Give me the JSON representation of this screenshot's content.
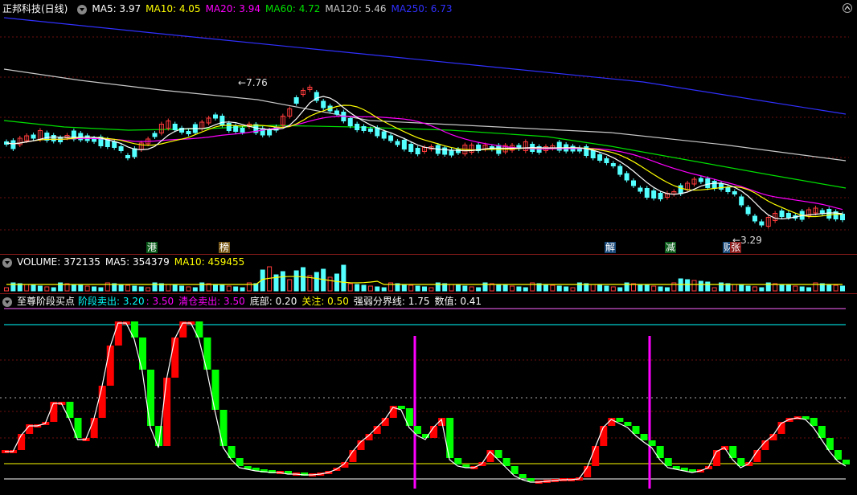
{
  "main": {
    "title": "正邦科技(日线)",
    "ma5": "MA5: 3.97",
    "ma10": "MA10: 4.05",
    "ma20": "MA20: 3.94",
    "ma60": "MA60: 4.72",
    "ma120": "MA120: 5.46",
    "ma250": "MA250: 6.73",
    "high_label": "7.76",
    "low_label": "3.29",
    "tags": [
      "港",
      "榜",
      "解",
      "减",
      "财",
      "张"
    ]
  },
  "volume": {
    "label": "VOLUME: 372135",
    "ma5": "MA5: 354379",
    "ma10": "MA10: 459455"
  },
  "indicator": {
    "title": "至尊阶段买点",
    "stage_sell": "阶段卖出: 3.20",
    "colon_val": ": 3.50",
    "clear_sell": "清仓卖出: 3.50",
    "bottom": "底部: 0.20",
    "focus": "关注: 0.50",
    "divide": "强弱分界线: 1.75",
    "value": "数值: 0.41"
  },
  "colors": {
    "up": "#ff3c3c",
    "down": "#54ffff",
    "ma5": "#ffffff",
    "ma10": "#ffff00",
    "ma20": "#ff00ff",
    "ma60": "#00e000",
    "ma120": "#c8c8c8",
    "ma250": "#3030ff",
    "ind_up": "#ff0000",
    "ind_down": "#00ff00",
    "magenta": "#ff00ff",
    "cyan": "#00ffff"
  }
}
